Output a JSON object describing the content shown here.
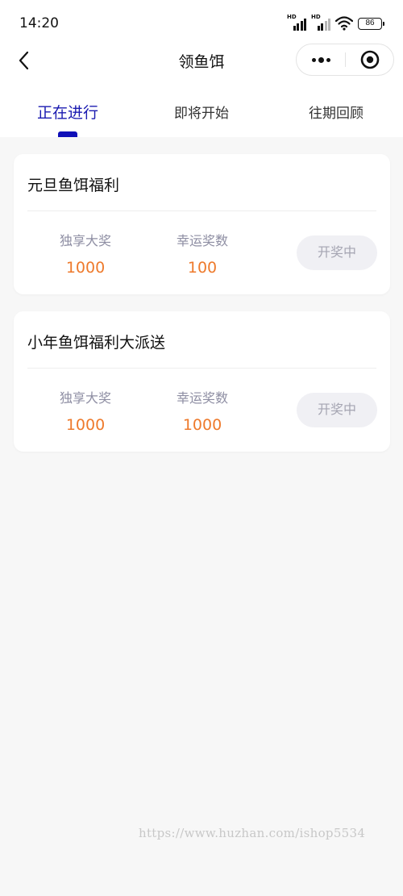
{
  "status_bar": {
    "time": "14:20",
    "signal1_label": "HD",
    "signal2_label": "HD",
    "battery": "86"
  },
  "nav": {
    "title": "领鱼饵",
    "back_icon": "chevron-left-icon",
    "more_icon": "more-dots-icon",
    "close_icon": "target-circle-icon"
  },
  "tabs": [
    {
      "label": "正在进行",
      "active": true
    },
    {
      "label": "即将开始",
      "active": false
    },
    {
      "label": "往期回顾",
      "active": false
    }
  ],
  "colors": {
    "active_tab": "#1a1ab0",
    "value": "#ee7a2c",
    "label": "#8e8ea3",
    "button_bg": "#f0f0f4",
    "button_text": "#a5a5b2"
  },
  "cards": [
    {
      "title": "元旦鱼饵福利",
      "stat1_label": "独享大奖",
      "stat1_value": "1000",
      "stat2_label": "幸运奖数",
      "stat2_value": "100",
      "button": "开奖中"
    },
    {
      "title": "小年鱼饵福利大派送",
      "stat1_label": "独享大奖",
      "stat1_value": "1000",
      "stat2_label": "幸运奖数",
      "stat2_value": "1000",
      "button": "开奖中"
    }
  ],
  "watermark": "https://www.huzhan.com/ishop5534"
}
